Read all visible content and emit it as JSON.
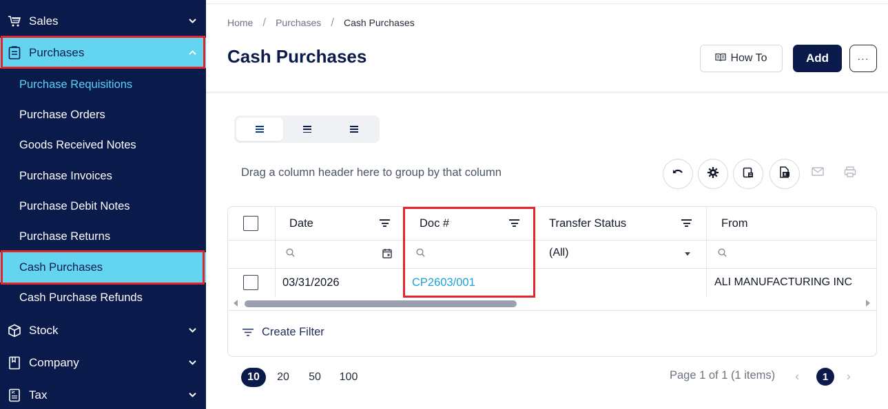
{
  "sidebar": {
    "sales": {
      "label": "Sales"
    },
    "purchases": {
      "label": "Purchases"
    },
    "sub_items": [
      {
        "label": "Purchase Requisitions"
      },
      {
        "label": "Purchase Orders"
      },
      {
        "label": "Goods Received Notes"
      },
      {
        "label": "Purchase Invoices"
      },
      {
        "label": "Purchase Debit Notes"
      },
      {
        "label": "Purchase Returns"
      },
      {
        "label": "Cash Purchases"
      },
      {
        "label": "Cash Purchase Refunds"
      }
    ],
    "stock": {
      "label": "Stock"
    },
    "company": {
      "label": "Company"
    },
    "tax": {
      "label": "Tax"
    },
    "colors": {
      "background": "#0a1a4a",
      "active": "#63d5f1",
      "highlight_border": "#e0262a"
    }
  },
  "breadcrumb": {
    "home": "Home",
    "section": "Purchases",
    "current": "Cash Purchases",
    "separator": "/"
  },
  "header": {
    "title": "Cash Purchases",
    "howto_label": "How To",
    "add_label": "Add",
    "more_label": "···"
  },
  "toolbar": {
    "group_hint": "Drag a column header here to group by that column"
  },
  "grid": {
    "columns": [
      {
        "label": "Date"
      },
      {
        "label": "Doc #"
      },
      {
        "label": "Transfer Status"
      },
      {
        "label": "From"
      }
    ],
    "filter_row": {
      "transfer_status_value": "(All)"
    },
    "rows": [
      {
        "date": "03/31/2026",
        "doc": "CP2603/001",
        "transfer_status": "",
        "from": "ALI MANUFACTURING INC"
      }
    ],
    "create_filter_label": "Create Filter"
  },
  "pager": {
    "sizes": [
      "10",
      "20",
      "50",
      "100"
    ],
    "selected_size": "10",
    "info": "Page 1 of 1 (1 items)",
    "current_page": "1"
  }
}
